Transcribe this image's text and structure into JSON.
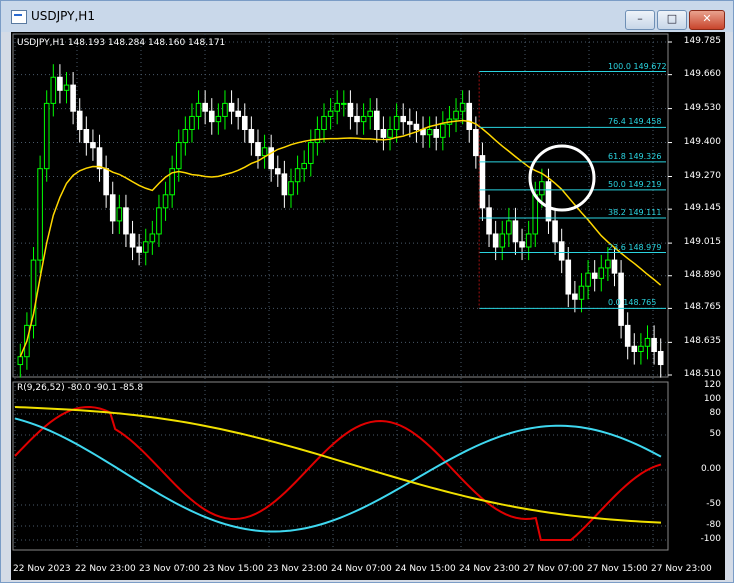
{
  "window": {
    "title": "USDJPY,H1",
    "min": "–",
    "max": "□",
    "close": "✕"
  },
  "symbol_line": "USDJPY,H1  148.193 148.284 148.160 148.171",
  "indicator_line": "R(9,26,52) -80.0 -90.1 -85.8",
  "price_ticks": [
    "149.785",
    "149.660",
    "149.530",
    "149.400",
    "149.270",
    "149.145",
    "149.015",
    "148.890",
    "148.765",
    "148.635",
    "148.510"
  ],
  "ind_ticks": [
    "120",
    "100",
    "80",
    "50",
    "0.00",
    "-50",
    "-80",
    "-100"
  ],
  "time_ticks": [
    "22 Nov 2023",
    "22 Nov 23:00",
    "23 Nov 07:00",
    "23 Nov 15:00",
    "23 Nov 23:00",
    "24 Nov 07:00",
    "24 Nov 15:00",
    "24 Nov 23:00",
    "27 Nov 07:00",
    "27 Nov 15:00",
    "27 Nov 23:00"
  ],
  "fib_labels": [
    "100.0  149.672",
    "76.4  149.458",
    "61.8  149.326",
    "50.0  149.219",
    "38.2  149.111",
    "23.6  148.979",
    "0.0  148.765"
  ],
  "colors": {
    "bull": "#00ff00",
    "bear": "#ffffff",
    "ma": "#ffd700",
    "fib": "#2ad4e0",
    "red": "#e00000",
    "cyan": "#3fd8f0",
    "yellow": "#f0e000",
    "grid": "#4a5a6a"
  }
}
